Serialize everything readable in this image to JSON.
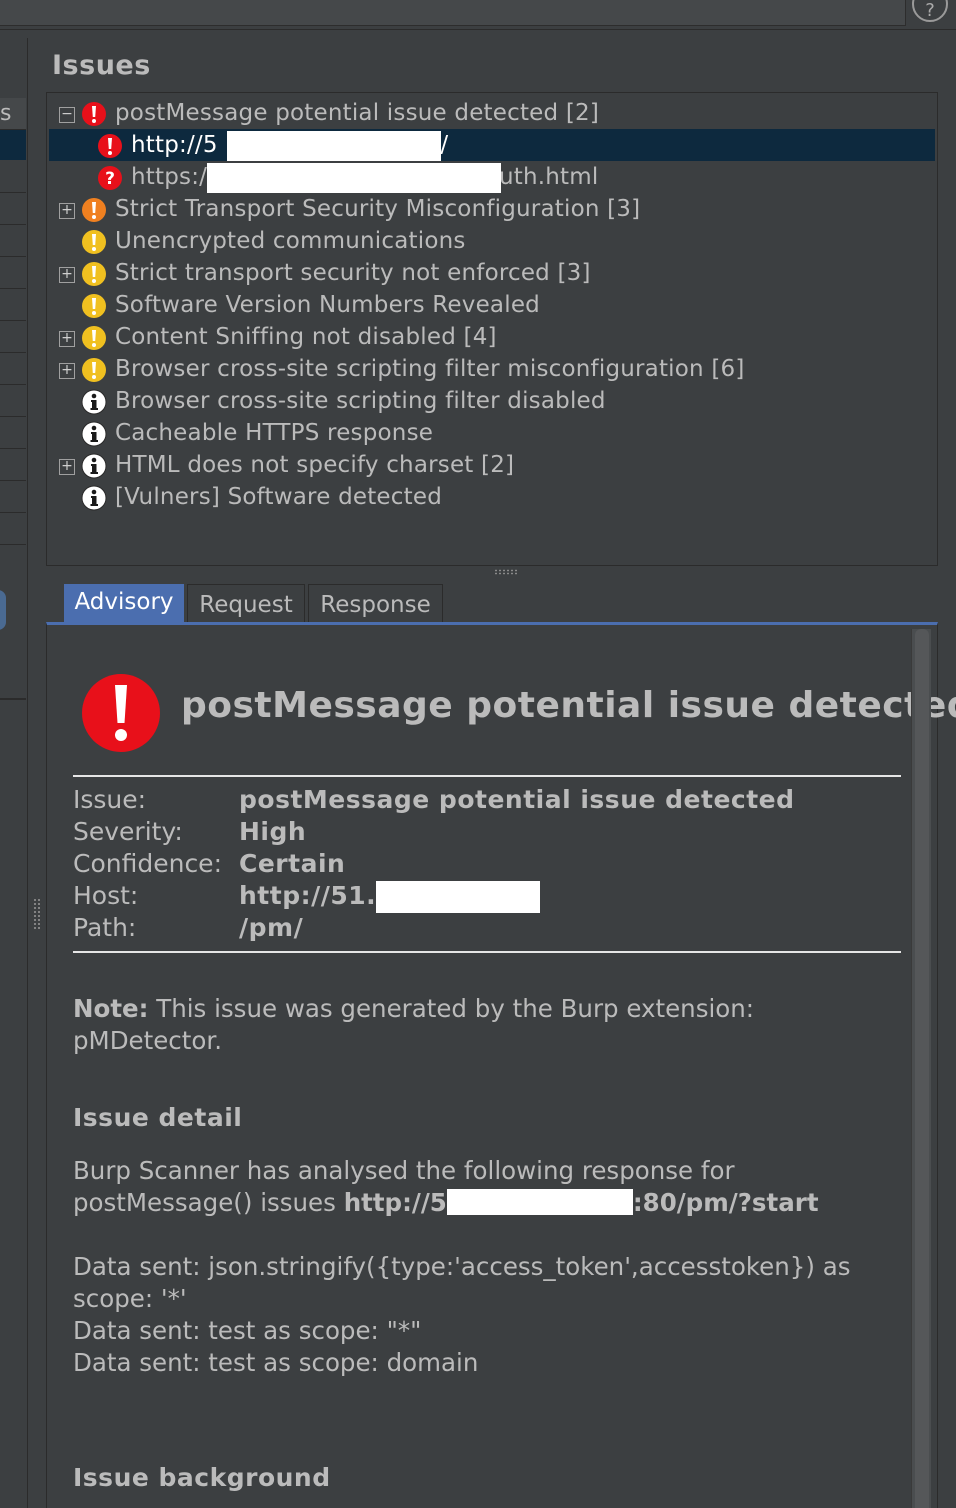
{
  "issues_panel": {
    "title": "Issues",
    "tree": [
      {
        "label": "postMessage potential issue detected [2]",
        "severity": "high",
        "expander": "minus",
        "indent": 0
      },
      {
        "label": "http://5",
        "label_suffix": "/pm/",
        "severity": "high",
        "indent": 1,
        "selected": true
      },
      {
        "label": "https:/",
        "label_suffix": "uth.html",
        "severity": "tentative-high",
        "indent": 1
      },
      {
        "label": "Strict Transport Security Misconfiguration [3]",
        "severity": "medium",
        "expander": "plus",
        "indent": 0
      },
      {
        "label": "Unencrypted communications",
        "severity": "low",
        "indent": 0
      },
      {
        "label": "Strict transport security not enforced [3]",
        "severity": "low",
        "expander": "plus",
        "indent": 0
      },
      {
        "label": "Software Version Numbers Revealed",
        "severity": "low",
        "indent": 0
      },
      {
        "label": "Content Sniffing not disabled [4]",
        "severity": "low",
        "expander": "plus",
        "indent": 0
      },
      {
        "label": "Browser cross-site scripting filter misconfiguration [6]",
        "severity": "low",
        "expander": "plus",
        "indent": 0
      },
      {
        "label": "Browser cross-site scripting filter disabled",
        "severity": "info",
        "indent": 0
      },
      {
        "label": "Cacheable HTTPS response",
        "severity": "info",
        "indent": 0
      },
      {
        "label": "HTML does not specify charset [2]",
        "severity": "info",
        "expander": "plus",
        "indent": 0
      },
      {
        "label": "[Vulners] Software detected",
        "severity": "info-tentative",
        "indent": 0
      }
    ]
  },
  "tabs": [
    {
      "label": "Advisory",
      "active": true
    },
    {
      "label": "Request",
      "active": false
    },
    {
      "label": "Response",
      "active": false
    }
  ],
  "advisory": {
    "title": "postMessage potential issue detected",
    "fields": [
      {
        "key": "Issue:",
        "value": "postMessage potential issue detected"
      },
      {
        "key": "Severity:",
        "value": "High"
      },
      {
        "key": "Confidence:",
        "value": "Certain"
      },
      {
        "key": "Host:",
        "value": "http://51."
      },
      {
        "key": "Path:",
        "value": "/pm/"
      }
    ],
    "note_label": "Note:",
    "note_text": " This issue was generated by the Burp extension: pMDetector.",
    "detail_heading": "Issue detail",
    "detail_text": "Burp Scanner has analysed the following response for postMessage() issues ",
    "detail_url_prefix": "http://5",
    "detail_url_suffix": ":80/pm/?start",
    "data_sent_1": "Data sent: json.stringify({type:'access_token',accesstoken}) as scope: '*'",
    "data_sent_2": "Data sent: test as scope: \"*\"",
    "data_sent_3": "Data sent: test as scope: domain",
    "background_heading": "Issue background"
  },
  "left_pane": {
    "header_fragment": "s"
  },
  "help_button": {
    "label": "?"
  },
  "colors": {
    "background": "#3c3f41",
    "selection": "#0d293e",
    "active_tab": "#4b6eaf",
    "severity_high": "#e8101a",
    "severity_medium": "#f08020",
    "severity_low": "#f0c020",
    "severity_info": "#ffffff"
  }
}
